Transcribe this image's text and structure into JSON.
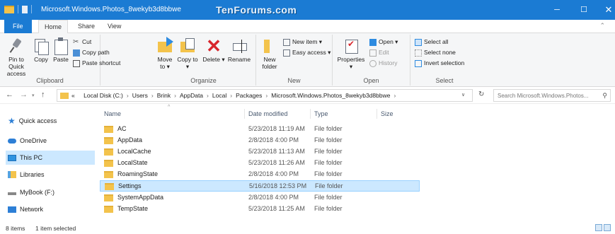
{
  "window": {
    "title": "Microsoft.Windows.Photos_8wekyb3d8bbwe",
    "watermark": "TenForums.com",
    "minimize": "─",
    "maximize": "☐",
    "close": "✕"
  },
  "ribbon_tabs": {
    "file": "File",
    "home": "Home",
    "share": "Share",
    "view": "View",
    "toggle": "⌃"
  },
  "clipboard": {
    "pin": "Pin to Quick access",
    "copy": "Copy",
    "paste": "Paste",
    "cut": "Cut",
    "copy_path": "Copy path",
    "paste_shortcut": "Paste shortcut",
    "label": "Clipboard"
  },
  "organize": {
    "move_to": "Move to ▾",
    "copy_to": "Copy to ▾",
    "delete": "Delete ▾",
    "rename": "Rename",
    "label": "Organize"
  },
  "new": {
    "new_folder": "New folder",
    "new_item": "New item ▾",
    "easy_access": "Easy access ▾",
    "label": "New"
  },
  "open": {
    "properties": "Properties ▾",
    "open": "Open ▾",
    "edit": "Edit",
    "history": "History",
    "label": "Open"
  },
  "select": {
    "select_all": "Select all",
    "select_none": "Select none",
    "invert": "Invert selection",
    "label": "Select"
  },
  "address": {
    "back": "←",
    "forward": "→",
    "recent": "▾",
    "up": "↑",
    "overflow": "«",
    "crumbs": [
      "Local Disk (C:)",
      "Users",
      "Brink",
      "AppData",
      "Local",
      "Packages",
      "Microsoft.Windows.Photos_8wekyb3d8bbwe"
    ],
    "separator": "›",
    "dropdown": "∨",
    "refresh": "↻",
    "search_placeholder": "Search Microsoft.Windows.Photos...",
    "search_icon": "⚲"
  },
  "nav_pane": {
    "items": [
      {
        "label": "Quick access",
        "icon": "star-icon"
      },
      {
        "label": "OneDrive",
        "icon": "cloud-icon"
      },
      {
        "label": "This PC",
        "icon": "pc-icon"
      },
      {
        "label": "Libraries",
        "icon": "library-icon"
      },
      {
        "label": "MyBook (F:)",
        "icon": "drive-icon"
      },
      {
        "label": "Network",
        "icon": "network-icon"
      }
    ],
    "selected": "This PC",
    "star_glyph": "★"
  },
  "file_list": {
    "columns": {
      "name": "Name",
      "date": "Date modified",
      "type": "Type",
      "size": "Size"
    },
    "sort_glyph": "^",
    "rows": [
      {
        "name": "AC",
        "date": "5/23/2018 11:19 AM",
        "type": "File folder"
      },
      {
        "name": "AppData",
        "date": "2/8/2018 4:00 PM",
        "type": "File folder"
      },
      {
        "name": "LocalCache",
        "date": "5/23/2018 11:13 AM",
        "type": "File folder"
      },
      {
        "name": "LocalState",
        "date": "5/23/2018 11:26 AM",
        "type": "File folder"
      },
      {
        "name": "RoamingState",
        "date": "2/8/2018 4:00 PM",
        "type": "File folder"
      },
      {
        "name": "Settings",
        "date": "5/16/2018 12:53 PM",
        "type": "File folder"
      },
      {
        "name": "SystemAppData",
        "date": "2/8/2018 4:00 PM",
        "type": "File folder"
      },
      {
        "name": "TempState",
        "date": "5/23/2018 11:25 AM",
        "type": "File folder"
      }
    ],
    "selected": "Settings"
  },
  "status_bar": {
    "item_count": "8 items",
    "selection": "1 item selected"
  }
}
